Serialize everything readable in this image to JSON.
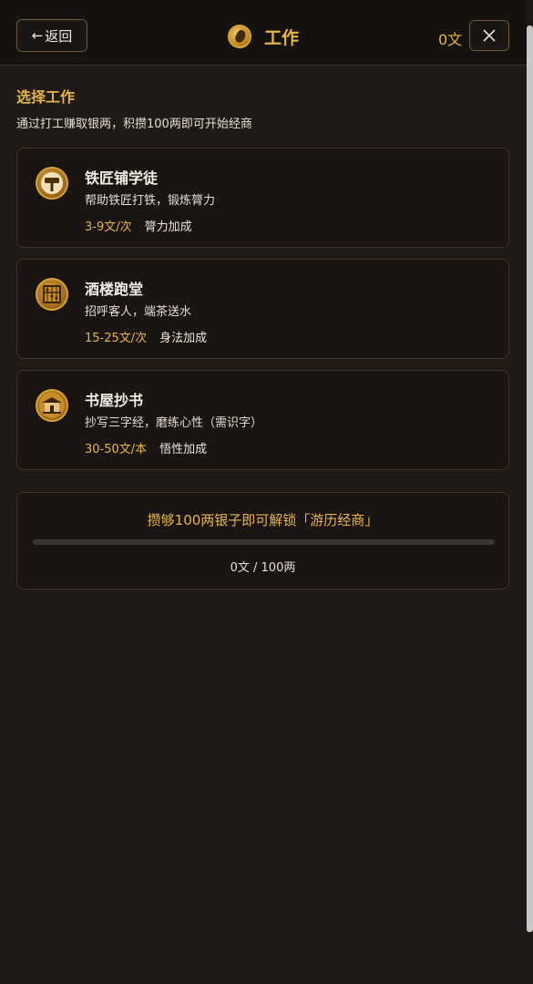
{
  "header": {
    "back_label": "返回",
    "title": "工作",
    "money": "0文"
  },
  "section": {
    "title": "选择工作",
    "description": "通过打工赚取银两，积攒100两即可开始经商"
  },
  "jobs": [
    {
      "name": "铁匠铺学徒",
      "description": "帮助铁匠打铁，锻炼膂力",
      "pay": "3-9文/次",
      "bonus": "膂力加成",
      "icon": "hammer-icon"
    },
    {
      "name": "酒楼跑堂",
      "description": "招呼客人，端茶送水",
      "pay": "15-25文/次",
      "bonus": "身法加成",
      "icon": "abacus-icon"
    },
    {
      "name": "书屋抄书",
      "description": "抄写三字经，磨练心性（需识字）",
      "pay": "30-50文/本",
      "bonus": "悟性加成",
      "icon": "bookhouse-icon"
    }
  ],
  "unlock": {
    "text": "攒够100两银子即可解锁「游历经商」",
    "progress_text": "0文 / 100两",
    "progress_fraction": 0
  },
  "colors": {
    "accent": "#e8b54a",
    "background": "#1f1a16",
    "card": "#1a1512"
  }
}
